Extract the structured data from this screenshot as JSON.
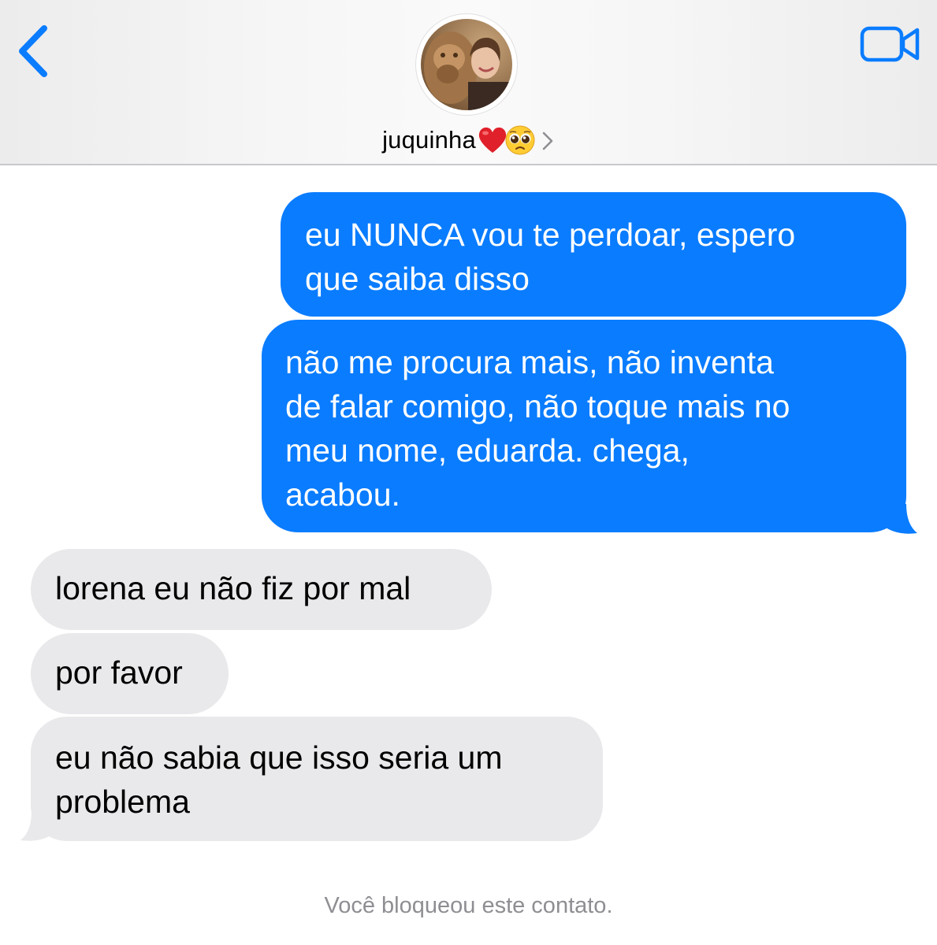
{
  "header": {
    "contact_name": "juquinha",
    "emojis": [
      "heart-emoji",
      "pleading-face-emoji"
    ],
    "icons": {
      "back": "chevron-left-icon",
      "video": "video-camera-icon",
      "disclosure": "chevron-right-icon"
    },
    "accent_color": "#0a7cff"
  },
  "messages": [
    {
      "direction": "sent",
      "text": "eu NUNCA vou te perdoar, espero\nque saiba disso"
    },
    {
      "direction": "sent",
      "text": "não me procura mais, não inventa\nde falar comigo, não toque mais no\nmeu nome, eduarda. chega,\nacabou."
    },
    {
      "direction": "received",
      "text": "lorena eu não fiz por mal"
    },
    {
      "direction": "received",
      "text": "por favor"
    },
    {
      "direction": "received",
      "text": "eu não sabia que isso seria um\nproblema"
    }
  ],
  "status": {
    "blocked_notice": "Você bloqueou este contato."
  },
  "colors": {
    "sent_bubble": "#0a7cff",
    "received_bubble": "#e9e9eb",
    "system_text": "#8e8e93"
  }
}
